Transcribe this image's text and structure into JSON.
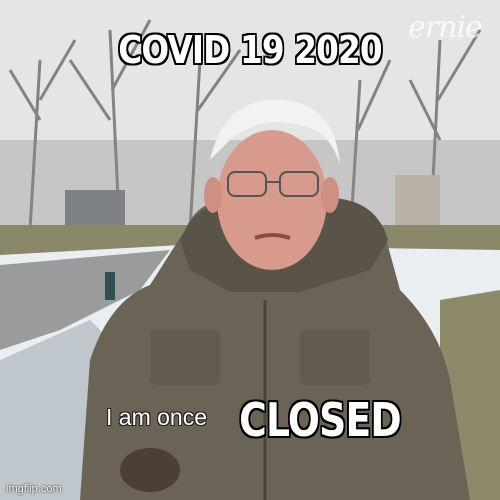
{
  "meme": {
    "top_text": "COVID 19 2020",
    "bottom_text": "CLOSED",
    "subtitle": "I am once",
    "watermark": "ernie",
    "credit": "imgflip.com"
  },
  "colors": {
    "sky": "#e6e8e8",
    "coat": "#6b6355",
    "snow": "#e9eef2",
    "road": "#9a9c9c",
    "skin": "#d89a8c",
    "hair": "#f2f2f2"
  }
}
